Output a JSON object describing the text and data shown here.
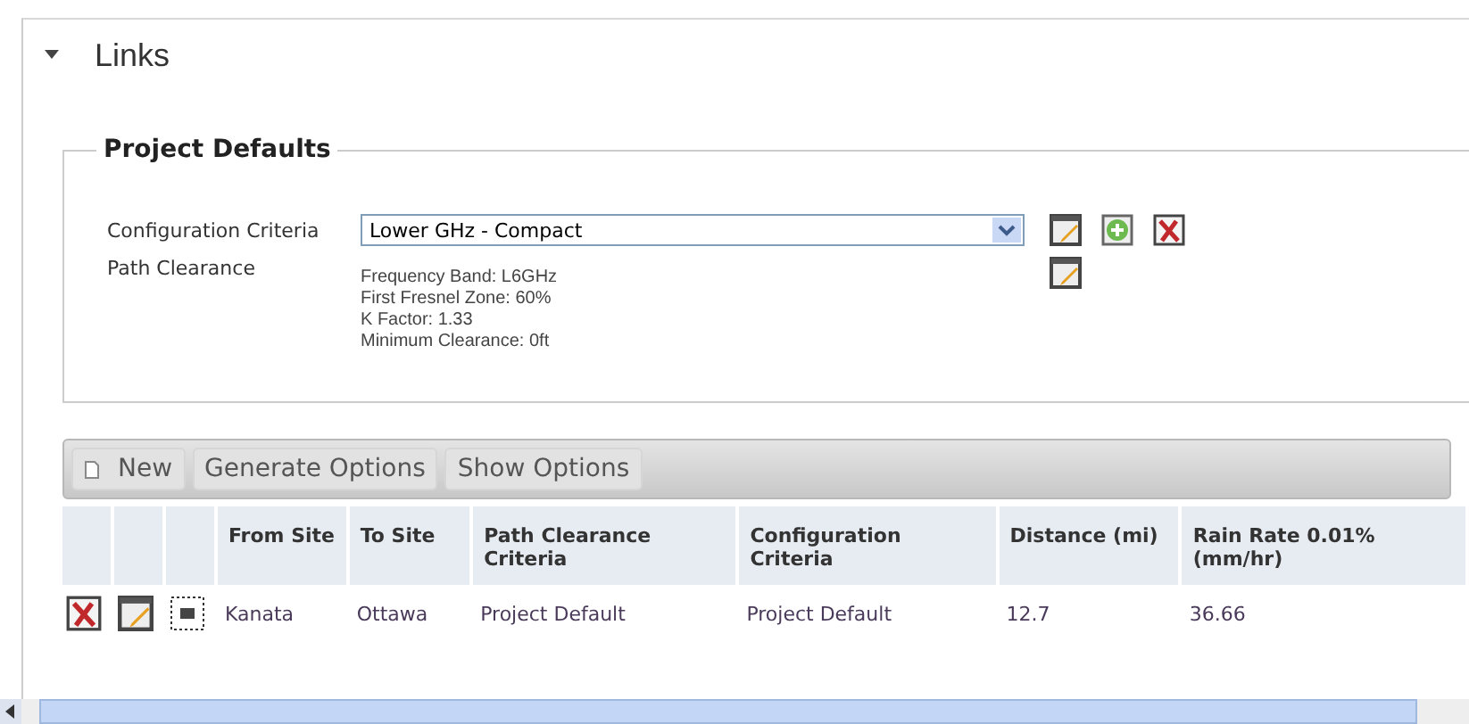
{
  "section": {
    "title": "Links",
    "expanded": true
  },
  "defaults": {
    "legend": "Project Defaults",
    "config_label": "Configuration Criteria",
    "config_value": "Lower GHz - Compact",
    "path_label": "Path Clearance",
    "path_lines": [
      "Frequency Band: L6GHz",
      "First Fresnel Zone: 60%",
      "K Factor: 1.33",
      "Minimum Clearance: 0ft"
    ]
  },
  "toolbar": [
    "New",
    "Generate Options",
    "Show Options"
  ],
  "table": {
    "columns": [
      "From Site",
      "To Site",
      "Path Clearance Criteria",
      "Configuration Criteria",
      "Distance (mi)",
      "Rain Rate 0.01% (mm/hr)"
    ],
    "rows": [
      {
        "cells": [
          "Kanata",
          "Ottawa",
          "Project Default",
          "Project Default",
          "12.7",
          "36.66"
        ]
      }
    ]
  }
}
